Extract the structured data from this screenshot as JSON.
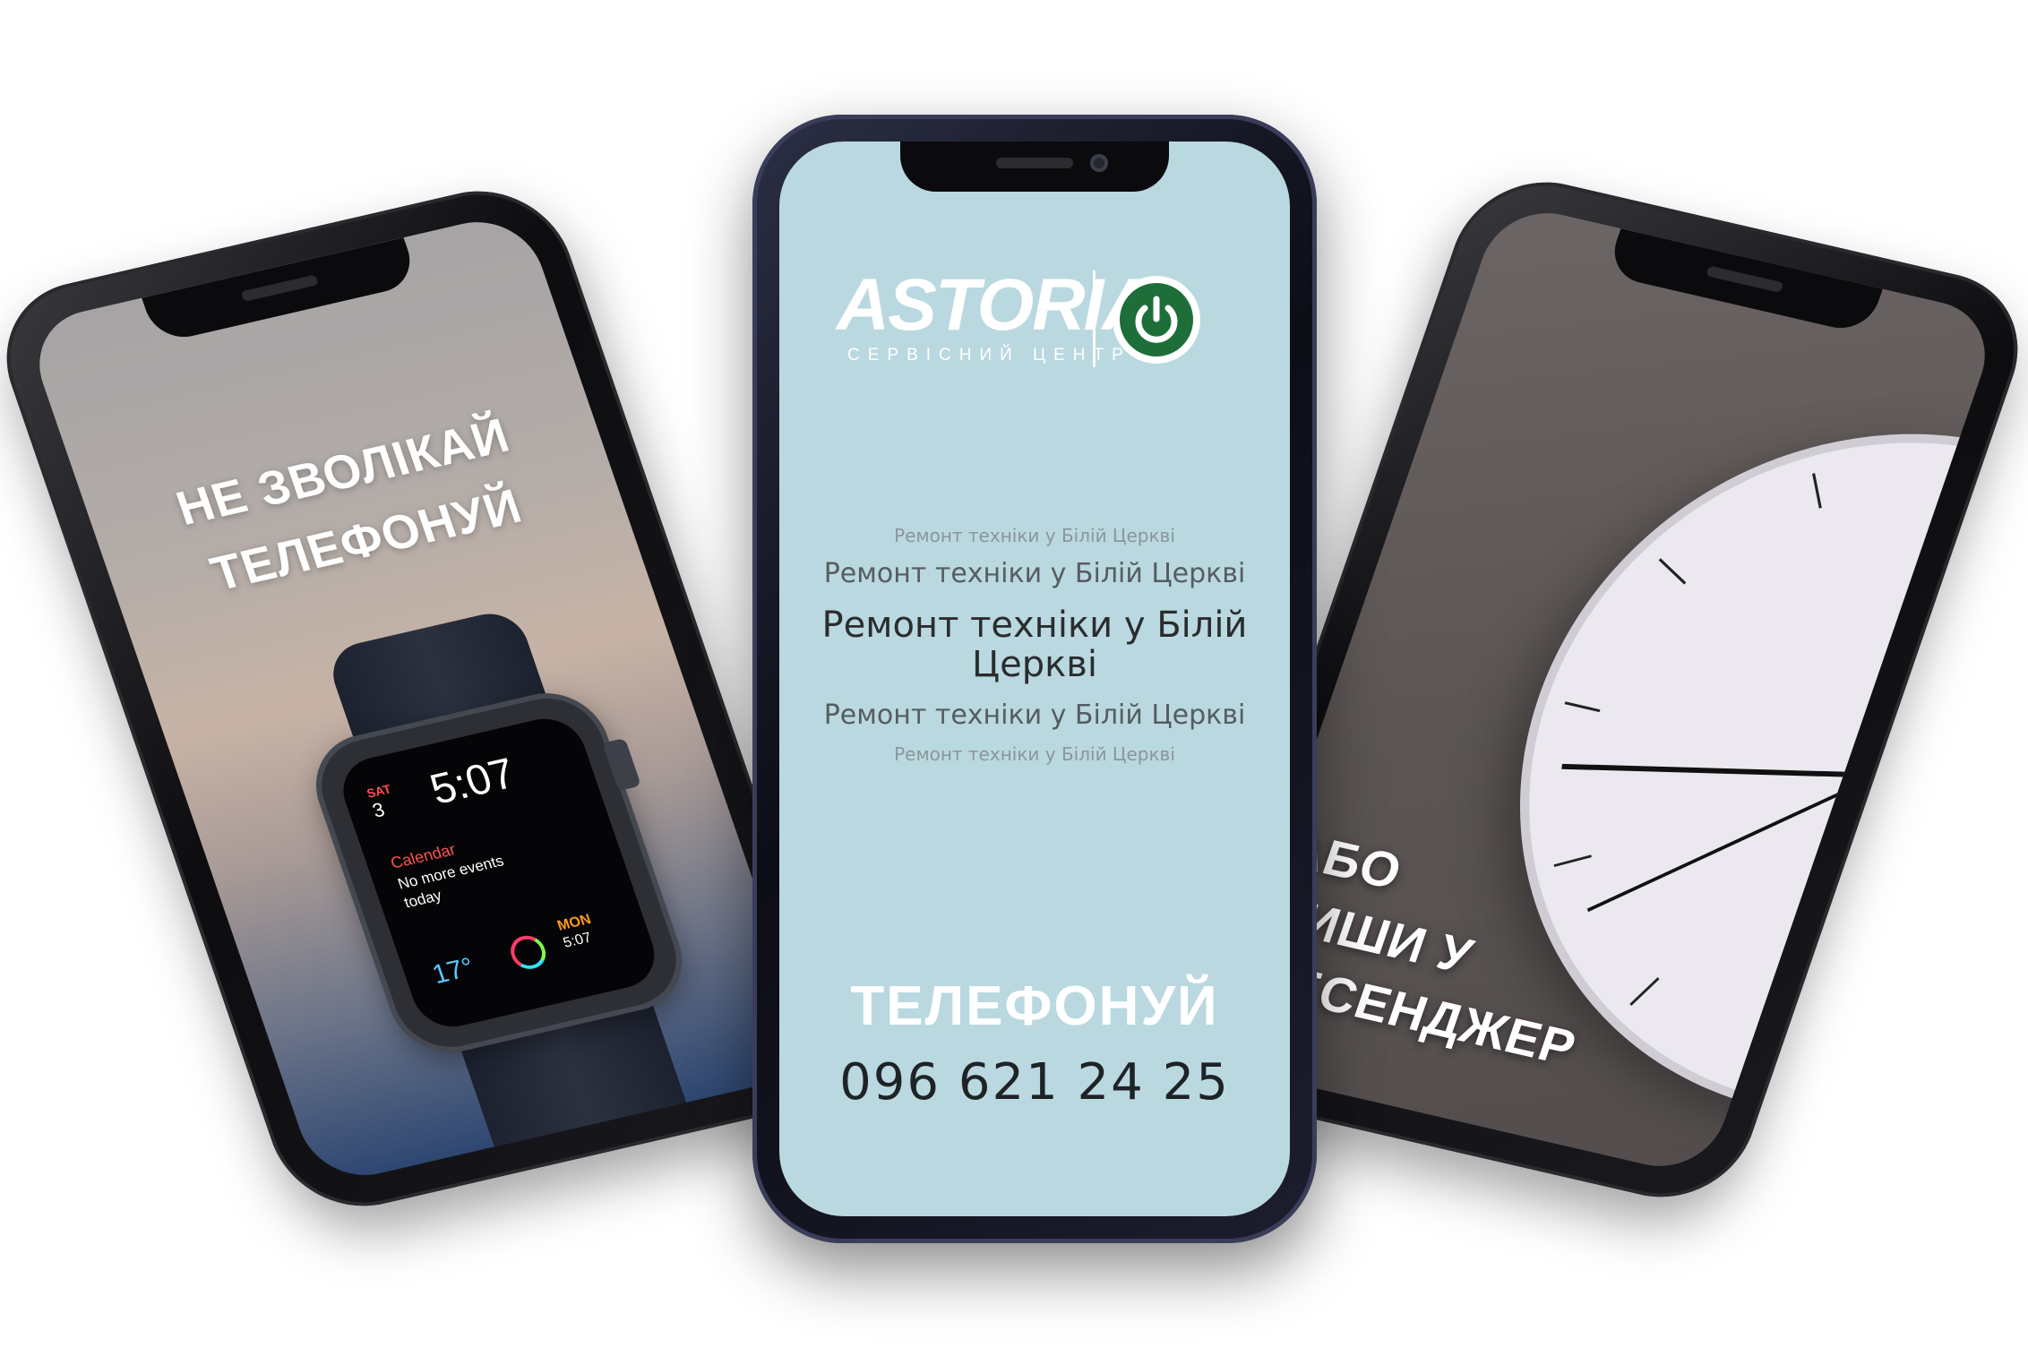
{
  "left_phone": {
    "headline_line1": "НЕ ЗВОЛІКАЙ",
    "headline_line2": "ТЕЛЕФОНУЙ",
    "watch": {
      "day": "SAT",
      "date": "3",
      "time": "5:07",
      "calendar_title": "Calendar",
      "calendar_text": "No more events today",
      "temperature": "17°",
      "second_day": "MON",
      "second_time": "5:07"
    }
  },
  "center_phone": {
    "logo_word": "ASTORIA",
    "logo_subtitle": "СЕРВІСНИЙ ЦЕНТР",
    "repair_lines": [
      "Ремонт техніки у Білій Церкві",
      "Ремонт техніки у Білій Церкві",
      "Ремонт техніки у Білій Церкві",
      "Ремонт техніки у Білій Церкві",
      "Ремонт техніки у Білій Церкві"
    ],
    "call_label": "ТЕЛЕФОНУЙ",
    "phone_number": "096 621 24 25",
    "colors": {
      "screen_bg": "#bad8e0",
      "power_green": "#1e6e3a"
    }
  },
  "right_phone": {
    "headline_line1": "АБО",
    "headline_line2": "ПИШИ У",
    "headline_line3": "МЕСЕНДЖЕР"
  }
}
